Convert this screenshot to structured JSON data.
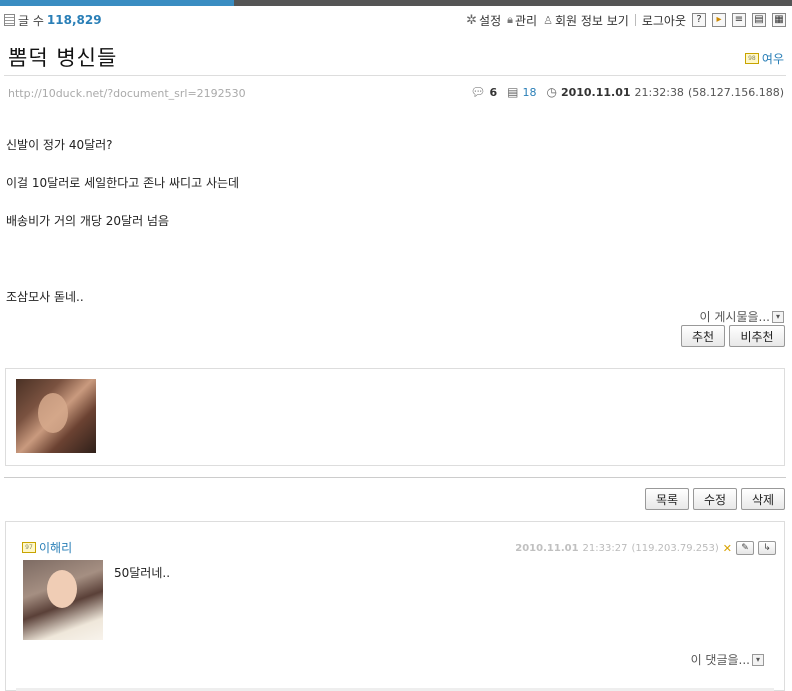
{
  "header": {
    "count_label": "글 수",
    "count_value": "118,829",
    "menu": {
      "settings": "설정",
      "manage": "관리",
      "member_info": "회원 정보 보기",
      "logout": "로그아웃"
    }
  },
  "post": {
    "title": "뽐덕 병신들",
    "author": "여우",
    "url": "http://10duck.net/?document_srl=2192530",
    "comment_count": "6",
    "read_count": "18",
    "date": "2010.11.01",
    "time": "21:32:38",
    "ip": "(58.127.156.188)",
    "lines": [
      "신발이 정가 40달러?",
      "이걸 10달러로 세일한다고 존나 싸디고 사는데",
      "배송비가 거의 개당 20달러 넘음",
      "조삼모사 돋네.."
    ],
    "bookmark_label": "이 게시물을...",
    "recommend": "추천",
    "not_recommend": "비추천"
  },
  "actions": {
    "list": "목록",
    "edit": "수정",
    "delete": "삭제"
  },
  "comment": {
    "author": "이해리",
    "date": "2010.11.01",
    "time": "21:33:27",
    "ip": "(119.203.79.253)",
    "text": "50달러네..",
    "bookmark_label": "이 댓글을..."
  },
  "colors": {
    "accent": "#3a8dc2",
    "link": "#2a7fb7"
  }
}
